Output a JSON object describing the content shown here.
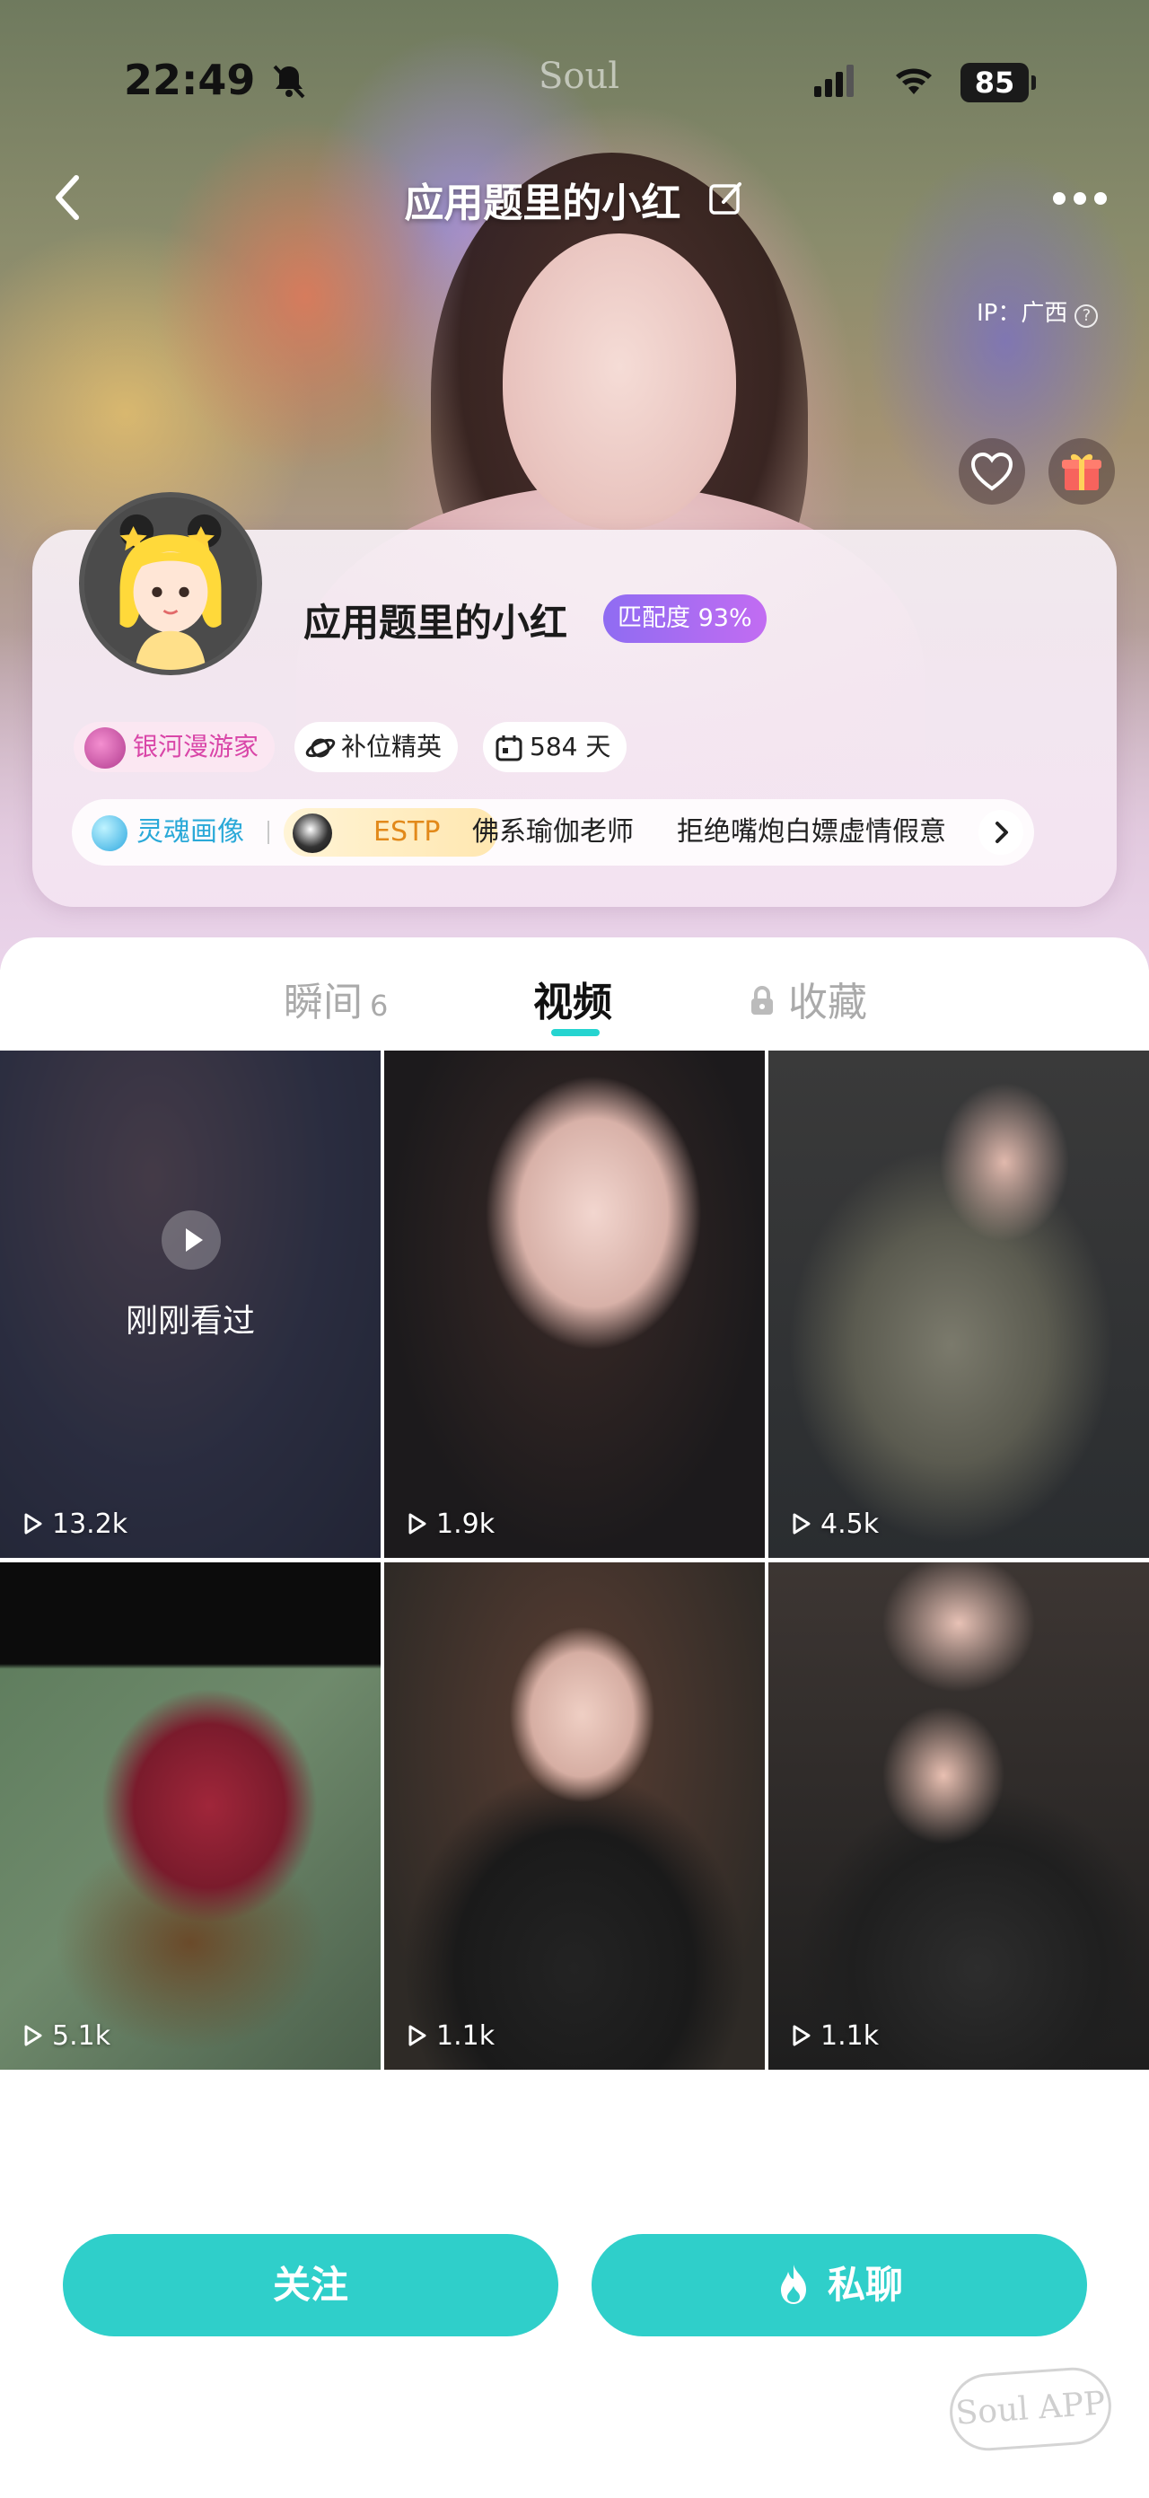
{
  "status_bar": {
    "time": "22:49",
    "carrier_logo": "Soul",
    "battery": "85"
  },
  "nav": {
    "title": "应用题里的小红"
  },
  "profile": {
    "ip_label": "IP：广西",
    "name": "应用题里的小红",
    "match_badge": "匹配度 93%",
    "tags": {
      "galaxy": "银河漫游家",
      "substitute": "补位精英",
      "days": "584 天"
    },
    "soul_portrait": {
      "label": "灵魂画像",
      "mbti": "ESTP",
      "tag1": "佛系瑜伽老师",
      "tag2": "拒绝嘴炮白嫖虚情假意"
    }
  },
  "tabs": {
    "moments": {
      "label": "瞬间",
      "count": "6"
    },
    "videos": {
      "label": "视频"
    },
    "favorites": {
      "label": "收藏"
    }
  },
  "videos": [
    {
      "views": "13.2k",
      "overlay_text": "刚刚看过"
    },
    {
      "views": "1.9k"
    },
    {
      "views": "4.5k"
    },
    {
      "views": "5.1k"
    },
    {
      "views": "1.1k"
    },
    {
      "views": "1.1k"
    }
  ],
  "actions": {
    "follow": "关注",
    "chat": "私聊"
  },
  "watermark": "Soul APP",
  "colors": {
    "accent": "#2fcfca",
    "tab_underline": "#25d4d0",
    "match_badge": "#a86cf2",
    "galaxy_tag": "#d946a8",
    "soul_label": "#2aa9d8",
    "mbti": "#e2891a"
  }
}
